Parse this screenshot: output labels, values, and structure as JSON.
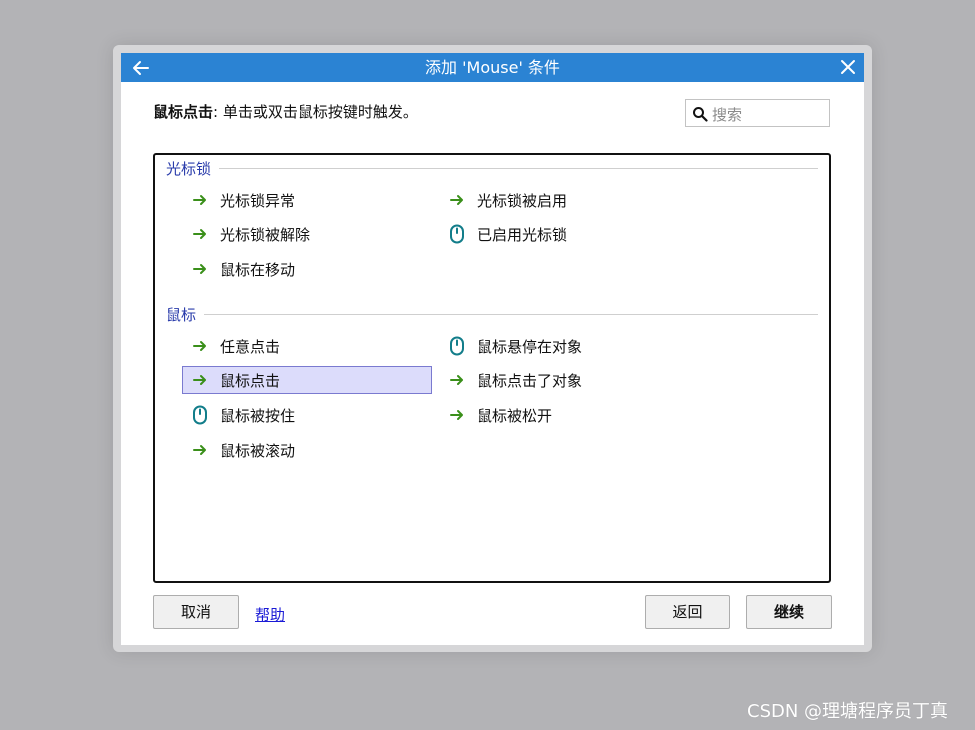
{
  "window": {
    "title": "添加 'Mouse' 条件"
  },
  "description": {
    "bold": "鼠标点击",
    "text": ": 单击或双击鼠标按键时触发。"
  },
  "search": {
    "placeholder": "搜索"
  },
  "groups": [
    {
      "label": "光标锁",
      "items": [
        {
          "label": "光标锁异常",
          "icon": "green-arrow-icon"
        },
        {
          "label": "光标锁被启用",
          "icon": "green-arrow-icon"
        },
        {
          "label": "光标锁被解除",
          "icon": "green-arrow-icon"
        },
        {
          "label": "已启用光标锁",
          "icon": "mouse-icon"
        },
        {
          "label": "鼠标在移动",
          "icon": "green-arrow-icon"
        }
      ]
    },
    {
      "label": "鼠标",
      "items": [
        {
          "label": "任意点击",
          "icon": "green-arrow-icon"
        },
        {
          "label": "鼠标悬停在对象",
          "icon": "mouse-icon"
        },
        {
          "label": "鼠标点击",
          "icon": "green-arrow-icon",
          "selected": true
        },
        {
          "label": "鼠标点击了对象",
          "icon": "green-arrow-icon"
        },
        {
          "label": "鼠标被按住",
          "icon": "mouse-icon"
        },
        {
          "label": "鼠标被松开",
          "icon": "green-arrow-icon"
        },
        {
          "label": "鼠标被滚动",
          "icon": "green-arrow-icon"
        }
      ]
    }
  ],
  "footer": {
    "cancel_label": "取消",
    "help_label": "帮助",
    "back_label": "返回",
    "continue_label": "继续"
  },
  "watermark": "CSDN @理塘程序员丁真",
  "colors": {
    "titlebar": "#2b83d3",
    "arrow": "#3a8f1a",
    "mouse_icon": "#127d8a",
    "group_label": "#2a3cab",
    "selected_bg": "#dcdcfb"
  }
}
